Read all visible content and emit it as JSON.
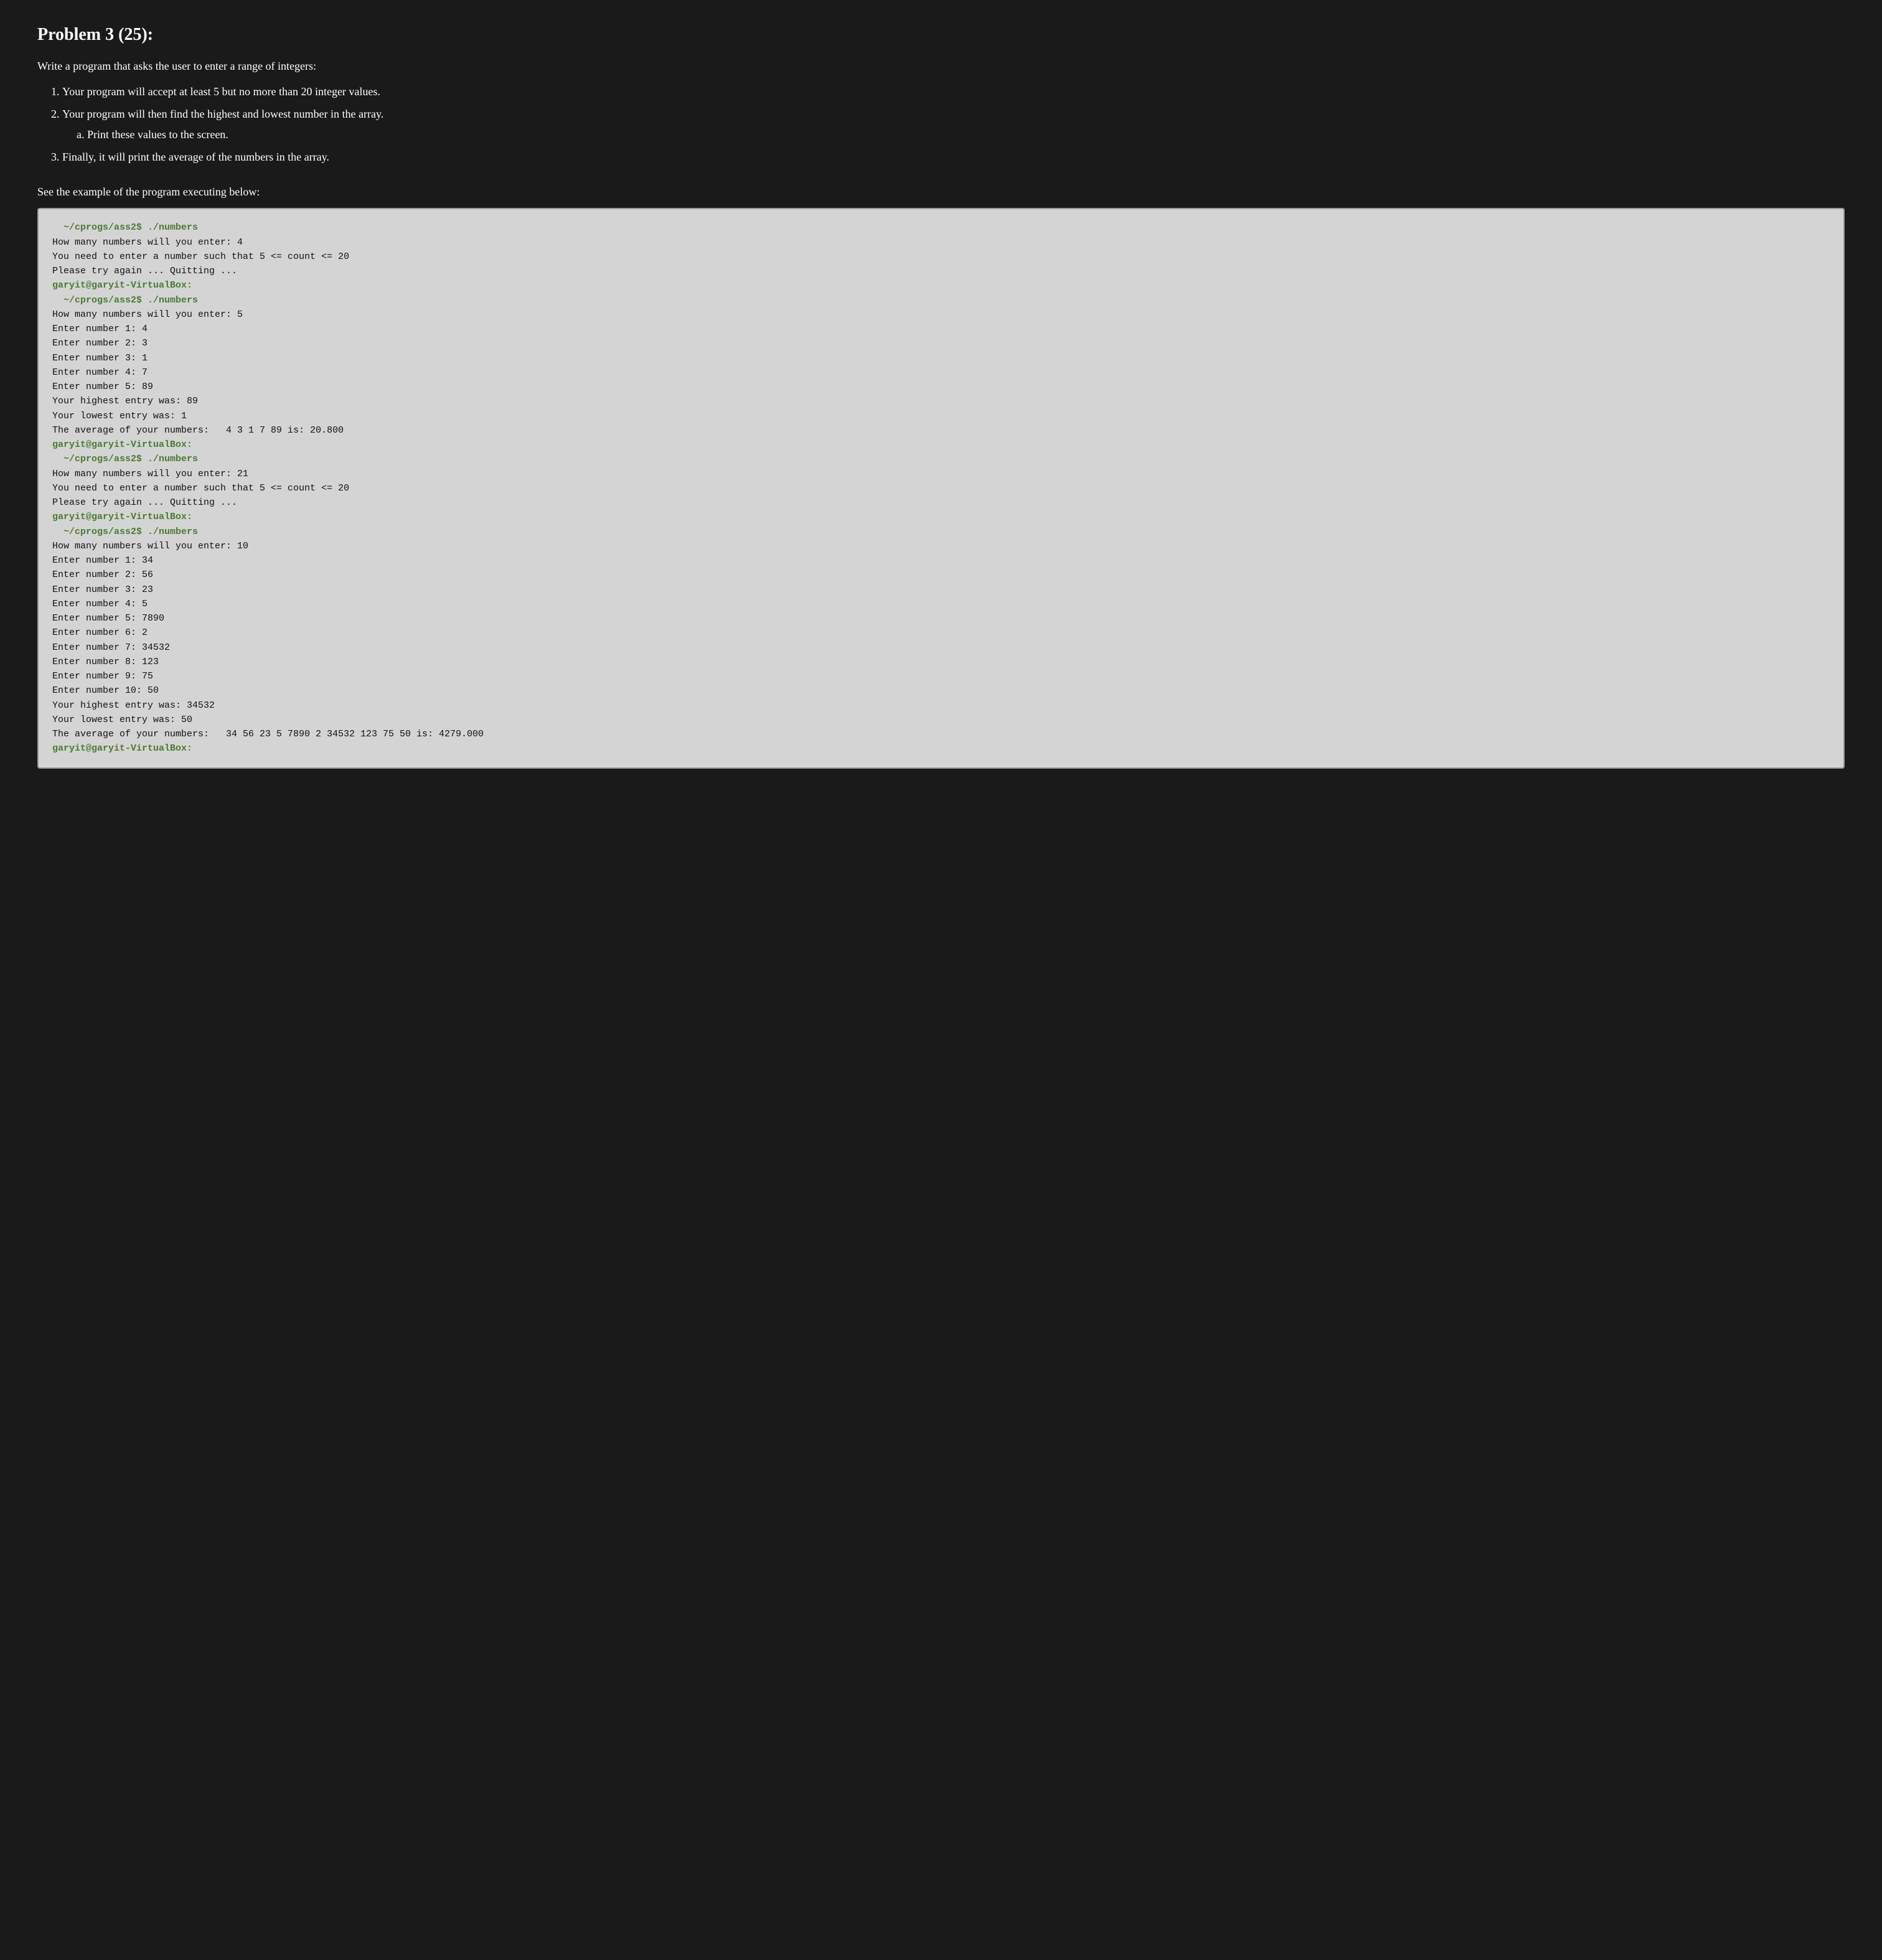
{
  "page": {
    "title": "Problem 3 (25):",
    "intro": "Write a program that asks the user to enter a range of integers:",
    "numbered_items": [
      {
        "text": "Your program will accept at least 5 but no more than 20 integer values.",
        "sub_items": []
      },
      {
        "text": "Your program will then find the highest and lowest number in the array.",
        "sub_items": [
          "Print these values to the screen."
        ]
      },
      {
        "text": "Finally, it will print the average of the numbers in the array.",
        "sub_items": []
      }
    ],
    "example_label": "See the example of the program executing below:",
    "terminal_lines": [
      {
        "type": "prompt",
        "text": "  ~/cprogs/ass2$ ./numbers"
      },
      {
        "type": "normal",
        "text": "How many numbers will you enter: 4"
      },
      {
        "type": "normal",
        "text": "You need to enter a number such that 5 <= count <= 20"
      },
      {
        "type": "normal",
        "text": "Please try again ... Quitting ..."
      },
      {
        "type": "prompt",
        "text": "garyit@garyit-VirtualBox:"
      },
      {
        "type": "prompt",
        "text": "  ~/cprogs/ass2$ ./numbers"
      },
      {
        "type": "normal",
        "text": "How many numbers will you enter: 5"
      },
      {
        "type": "normal",
        "text": "Enter number 1: 4"
      },
      {
        "type": "normal",
        "text": "Enter number 2: 3"
      },
      {
        "type": "normal",
        "text": "Enter number 3: 1"
      },
      {
        "type": "normal",
        "text": "Enter number 4: 7"
      },
      {
        "type": "normal",
        "text": "Enter number 5: 89"
      },
      {
        "type": "normal",
        "text": "Your highest entry was: 89"
      },
      {
        "type": "normal",
        "text": "Your lowest entry was: 1"
      },
      {
        "type": "normal",
        "text": "The average of your numbers:   4 3 1 7 89 is: 20.800"
      },
      {
        "type": "prompt",
        "text": "garyit@garyit-VirtualBox:"
      },
      {
        "type": "prompt",
        "text": "  ~/cprogs/ass2$ ./numbers"
      },
      {
        "type": "normal",
        "text": "How many numbers will you enter: 21"
      },
      {
        "type": "normal",
        "text": "You need to enter a number such that 5 <= count <= 20"
      },
      {
        "type": "normal",
        "text": "Please try again ... Quitting ..."
      },
      {
        "type": "prompt",
        "text": "garyit@garyit-VirtualBox:"
      },
      {
        "type": "prompt",
        "text": "  ~/cprogs/ass2$ ./numbers"
      },
      {
        "type": "normal",
        "text": "How many numbers will you enter: 10"
      },
      {
        "type": "normal",
        "text": "Enter number 1: 34"
      },
      {
        "type": "normal",
        "text": "Enter number 2: 56"
      },
      {
        "type": "normal",
        "text": "Enter number 3: 23"
      },
      {
        "type": "normal",
        "text": "Enter number 4: 5"
      },
      {
        "type": "normal",
        "text": "Enter number 5: 7890"
      },
      {
        "type": "normal",
        "text": "Enter number 6: 2"
      },
      {
        "type": "normal",
        "text": "Enter number 7: 34532"
      },
      {
        "type": "normal",
        "text": "Enter number 8: 123"
      },
      {
        "type": "normal",
        "text": "Enter number 9: 75"
      },
      {
        "type": "normal",
        "text": "Enter number 10: 50"
      },
      {
        "type": "normal",
        "text": "Your highest entry was: 34532"
      },
      {
        "type": "normal",
        "text": "Your lowest entry was: 50"
      },
      {
        "type": "normal",
        "text": "The average of your numbers:   34 56 23 5 7890 2 34532 123 75 50 is: 4279.000"
      },
      {
        "type": "prompt",
        "text": "garyit@garyit-VirtualBox:"
      }
    ]
  }
}
